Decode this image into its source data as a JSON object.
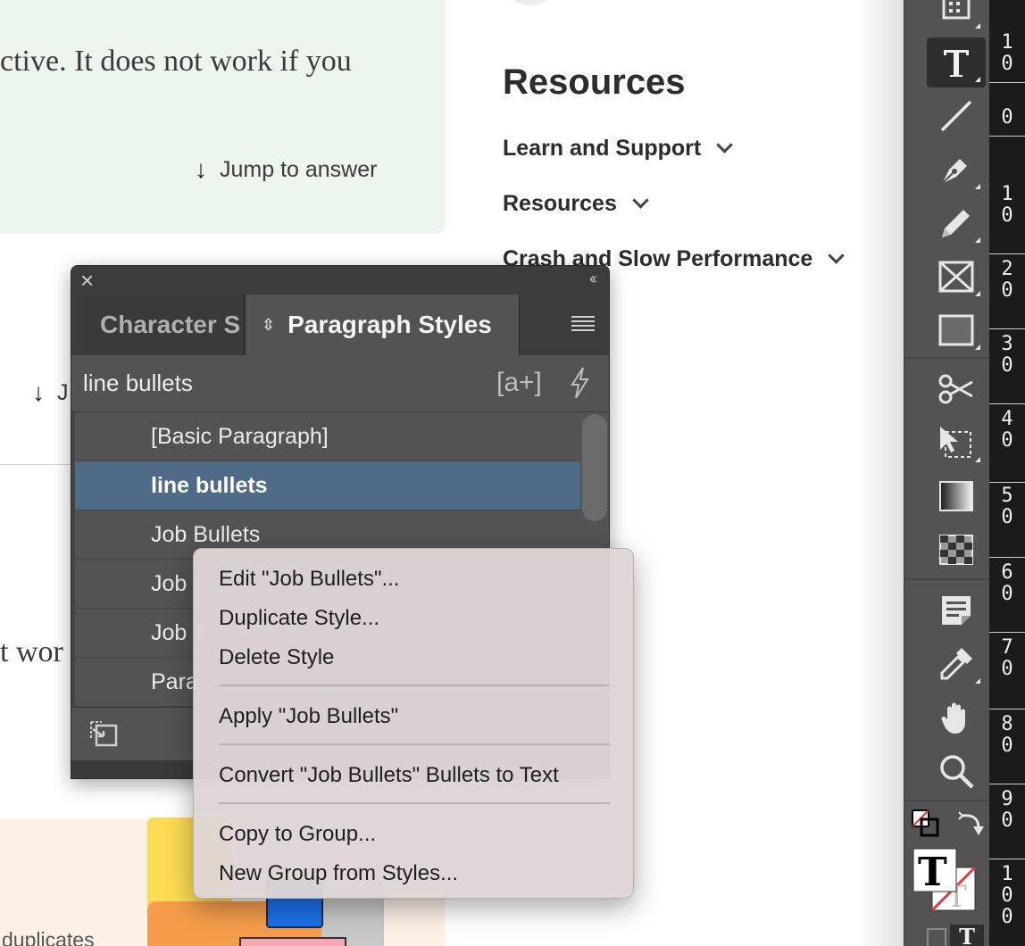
{
  "background": {
    "article_snippet_top": "ctive. It does not work if you",
    "jump_to_answer": "Jump to answer",
    "jump_partial": "J",
    "article_snippet_mid": "t wor",
    "bottom_partial": "duplicates",
    "resources": {
      "title": "Resources",
      "items": [
        {
          "label": "Learn and Support"
        },
        {
          "label": "Resources"
        },
        {
          "label": "Crash and Slow Performance"
        }
      ]
    }
  },
  "panel": {
    "tabs": [
      {
        "label": "Character S"
      },
      {
        "label": "Paragraph Styles"
      }
    ],
    "search_value": "line bullets",
    "new_group_glyph": "[a+]",
    "styles": [
      {
        "label": "[Basic Paragraph]"
      },
      {
        "label": "line bullets",
        "selected": true
      },
      {
        "label": "Job Bullets"
      },
      {
        "label": "Job"
      },
      {
        "label": "Job T"
      },
      {
        "label": "Para"
      }
    ]
  },
  "context_menu": {
    "items": [
      {
        "label": "Edit \"Job Bullets\"..."
      },
      {
        "label": "Duplicate Style..."
      },
      {
        "label": "Delete Style"
      },
      {
        "label": "Apply \"Job Bullets\""
      },
      {
        "label": "Convert \"Job Bullets\" Bullets to Text"
      },
      {
        "label": "Copy to Group..."
      },
      {
        "label": "New Group from Styles..."
      }
    ]
  },
  "toolbar": {
    "tools": [
      "frame-grid-icon",
      "type-tool-icon",
      "line-tool-icon",
      "pen-tool-icon",
      "pencil-tool-icon",
      "rectangle-frame-tool-icon",
      "rectangle-tool-icon",
      "scissors-tool-icon",
      "free-transform-tool-icon",
      "gradient-swatch-tool-icon",
      "gradient-feather-tool-icon",
      "note-tool-icon",
      "eyedropper-tool-icon",
      "hand-tool-icon",
      "zoom-tool-icon"
    ]
  },
  "ruler": {
    "marks": [
      "10",
      "0",
      "10",
      "20",
      "30",
      "40",
      "50",
      "60",
      "70",
      "80",
      "90",
      "100"
    ]
  },
  "colors": {
    "panel_bg": "#535353",
    "selected_row": "#4f6b86",
    "toolbar_bg": "#535353",
    "ruler_bg": "#1b1b1b",
    "green_card": "#edf6ec"
  }
}
